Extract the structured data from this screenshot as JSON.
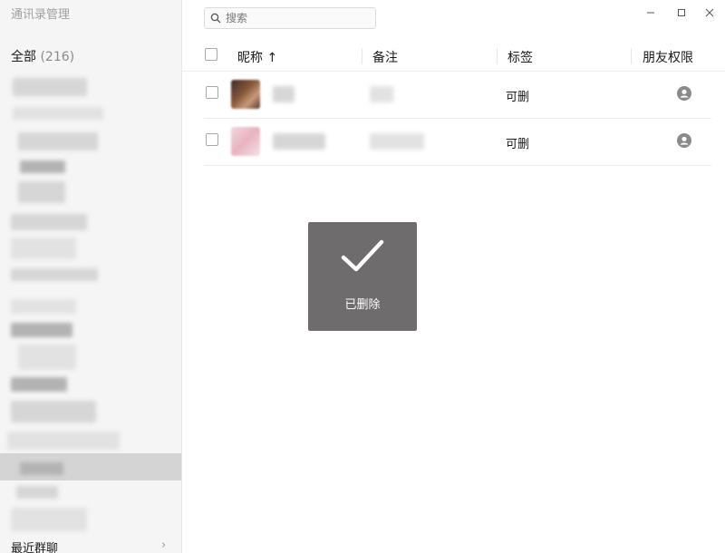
{
  "window": {
    "title": "通讯录管理",
    "controls": {
      "minimize_icon": "minimize-icon",
      "maximize_icon": "maximize-icon",
      "close_icon": "close-icon"
    }
  },
  "sidebar": {
    "all_label": "全部",
    "all_count": "(216)",
    "recent_groups_label": "最近群聊",
    "recent_groups_icon": "chevron-right-icon"
  },
  "search": {
    "placeholder": "搜索",
    "icon": "search-icon"
  },
  "table": {
    "headers": {
      "nickname": "昵称",
      "sort_indicator": "↑",
      "remark": "备注",
      "tag": "标签",
      "friend_permission": "朋友权限"
    },
    "rows": [
      {
        "tag": "可删",
        "permission_icon": "person-icon",
        "checked": false
      },
      {
        "tag": "可删",
        "permission_icon": "person-icon",
        "checked": false
      }
    ]
  },
  "toast": {
    "text": "已删除",
    "icon": "checkmark-icon"
  },
  "colors": {
    "toast_bg": "#6e6c6c",
    "sidebar_bg": "#f5f5f5",
    "selected_row": "#d4d4d4"
  }
}
